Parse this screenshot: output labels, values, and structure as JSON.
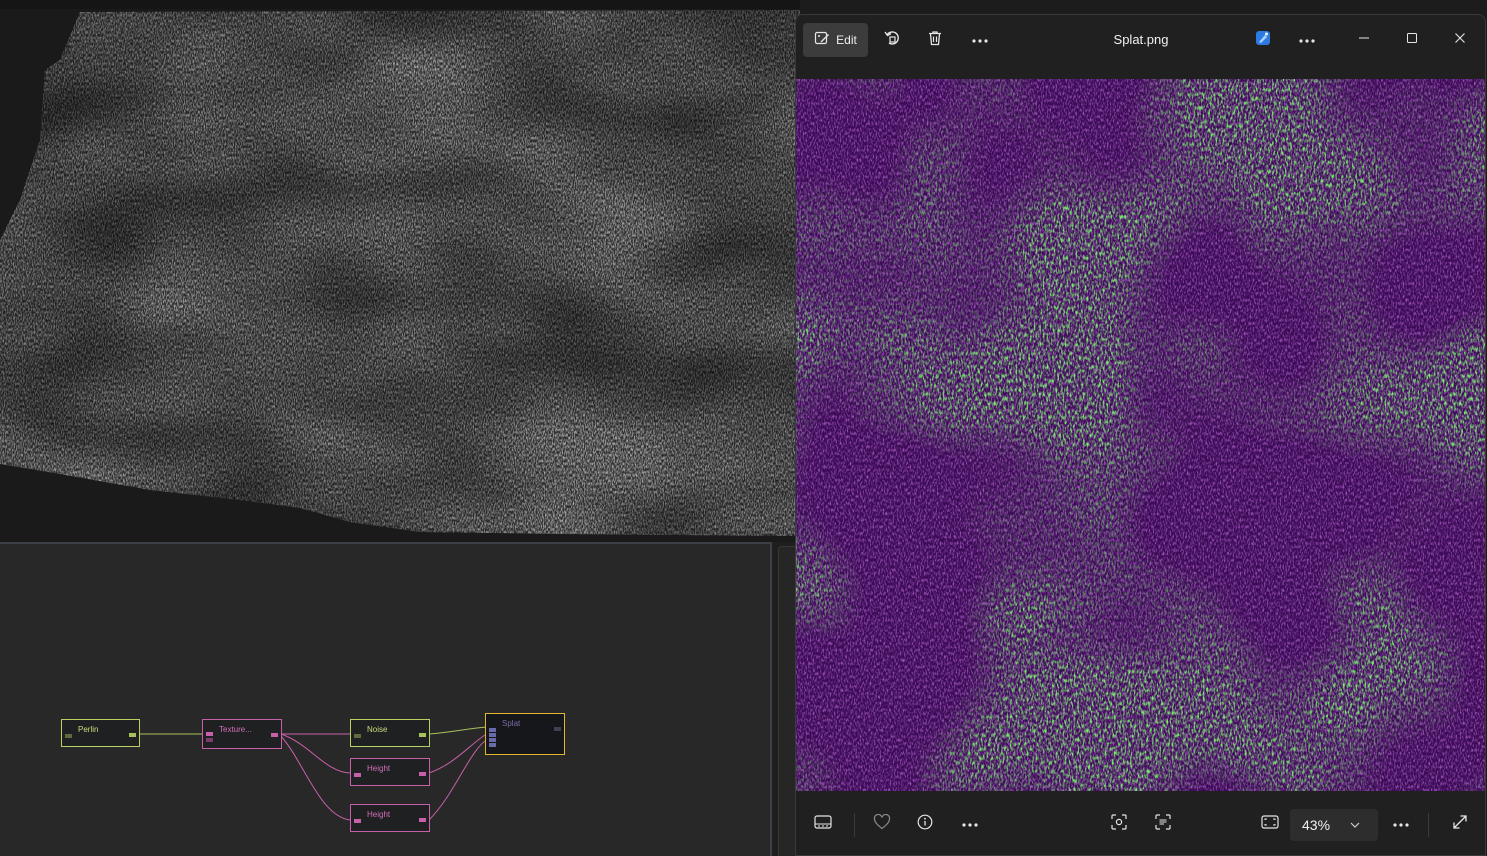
{
  "graph": {
    "nodes": [
      {
        "id": "perlin",
        "label": "Perlin",
        "kind": "green"
      },
      {
        "id": "texture",
        "label": "Texture...",
        "kind": "pink"
      },
      {
        "id": "noise",
        "label": "Noise",
        "kind": "green"
      },
      {
        "id": "height1",
        "label": "Height",
        "kind": "pink"
      },
      {
        "id": "height2",
        "label": "Height",
        "kind": "pink"
      },
      {
        "id": "splat",
        "label": "Splat",
        "kind": "output"
      }
    ]
  },
  "photos": {
    "toolbar": {
      "edit_label": "Edit",
      "edit_icon": "edit-image-icon",
      "rotate_icon": "rotate-icon",
      "delete_icon": "trash-icon",
      "more_icon": "more-icon"
    },
    "file_title": "Splat.png",
    "app_icon": "designer-icon",
    "window_controls": [
      "minimize-icon",
      "maximize-icon",
      "close-icon"
    ],
    "bottombar": {
      "zoom_value": "43%",
      "icons": [
        "filmstrip-icon",
        "heart-icon",
        "info-icon",
        "more-icon",
        "visual-search-icon",
        "text-scan-icon",
        "fit-window-icon",
        "expand-icon"
      ]
    }
  },
  "colors": {
    "splat_base": "#3b0b55",
    "splat_accent": "#33d52a",
    "node_green": "#b8d162",
    "node_pink": "#c75fa9",
    "node_output": "#e3b62f"
  }
}
